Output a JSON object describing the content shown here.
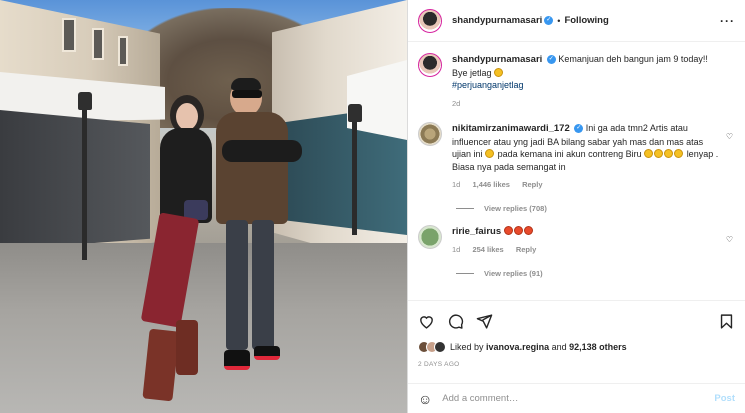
{
  "photo": {},
  "header": {
    "username": "shandypurnamasari",
    "follow_state": "Following",
    "separator": "•"
  },
  "comments": [
    {
      "username": "shandypurnamasari",
      "verified": true,
      "text": "Kemanjuan deh bangun jam 9 today!! Bye jetlag",
      "hashtag": "#perjuanganjetlag",
      "time": "2d"
    },
    {
      "username": "nikitamirzanimawardi_172",
      "verified": true,
      "text": "Ini ga ada tmn2 Artis atau influencer atau yng jadi BA bilang sabar yah mas dan mas atas ujian ini",
      "text_2": "pada kemana ini akun contreng Biru",
      "text_3": "lenyap . Biasa nya pada semangat in",
      "time": "1d",
      "likes": "1,446 likes",
      "reply": "Reply",
      "view_replies": "View replies (708)"
    },
    {
      "username": "ririe_fairus",
      "verified": false,
      "time": "1d",
      "likes": "254 likes",
      "reply": "Reply",
      "view_replies": "View replies (91)"
    }
  ],
  "likes": {
    "prefix": "Liked by",
    "user": "ivanova.regina",
    "and": "and",
    "count": "92,138 others"
  },
  "date": "2 DAYS AGO",
  "add_comment": {
    "placeholder": "Add a comment…",
    "post_label": "Post"
  },
  "colors": {
    "verified": "#3897f0",
    "hashtag": "#00376b",
    "post_disabled": "#b2dffc"
  }
}
